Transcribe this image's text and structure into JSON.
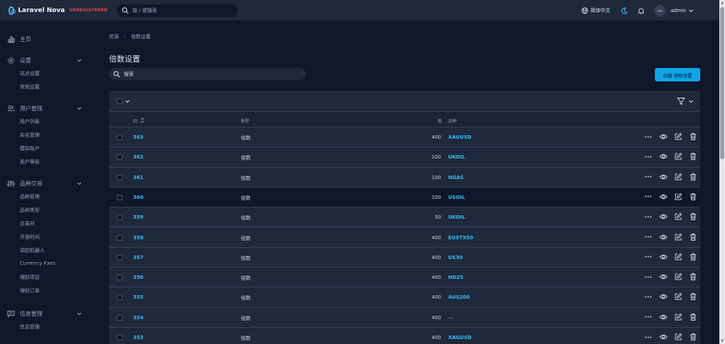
{
  "app": {
    "name": "Laravel Nova",
    "license_badge": "UNREGISTERED",
    "search_placeholder": "按 / 键搜索",
    "language": "简体中文",
    "user": {
      "name": "admin",
      "avatar_alt": "idm"
    }
  },
  "sidebar": {
    "groups": [
      {
        "label": "主页",
        "icon": "chart-bar-icon",
        "items": []
      },
      {
        "label": "设置",
        "icon": "gear-icon",
        "items": [
          "站点设置",
          "常规设置"
        ]
      },
      {
        "label": "用户管理",
        "icon": "users-icon",
        "items": [
          "用户列表",
          "实名管理",
          "模拟账户",
          "用户等级"
        ]
      },
      {
        "label": "品种交易",
        "icon": "adjustments-icon",
        "items": [
          "品种管理",
          "品种类型",
          "交易对",
          "开盘时间",
          "调控机器人",
          "Currency Kxes",
          "理财项目",
          "理财订单"
        ]
      },
      {
        "label": "信息管理",
        "icon": "chat-icon",
        "items": [
          "信息管理"
        ]
      }
    ]
  },
  "breadcrumb": {
    "root": "资源",
    "current": "倍数设置"
  },
  "page": {
    "title": "倍数设置",
    "search_placeholder": "搜索",
    "create_button": "创建 倍数设置"
  },
  "table": {
    "columns": {
      "id": "ID",
      "type": "类型",
      "value": "值",
      "symbol": "品种"
    },
    "rows": [
      {
        "id": "363",
        "type": "倍数",
        "value": "400",
        "symbol": "XAUUSD"
      },
      {
        "id": "362",
        "type": "倍数",
        "value": "100",
        "symbol": "UKOIL"
      },
      {
        "id": "361",
        "type": "倍数",
        "value": "100",
        "symbol": "NGAS"
      },
      {
        "id": "360",
        "type": "倍数",
        "value": "100",
        "symbol": "USOIL"
      },
      {
        "id": "359",
        "type": "倍数",
        "value": "50",
        "symbol": "UKOIL"
      },
      {
        "id": "358",
        "type": "倍数",
        "value": "400",
        "symbol": "EUSTX50"
      },
      {
        "id": "357",
        "type": "倍数",
        "value": "400",
        "symbol": "US30"
      },
      {
        "id": "356",
        "type": "倍数",
        "value": "400",
        "symbol": "ND25"
      },
      {
        "id": "355",
        "type": "倍数",
        "value": "400",
        "symbol": "AUS200"
      },
      {
        "id": "354",
        "type": "倍数",
        "value": "400",
        "symbol": "—"
      },
      {
        "id": "353",
        "type": "倍数",
        "value": "400",
        "symbol": "XAGUSD"
      }
    ]
  },
  "colors": {
    "accent": "#38bdf8",
    "background": "#0f172a",
    "panel": "#1e293b",
    "danger": "#ef4444"
  }
}
